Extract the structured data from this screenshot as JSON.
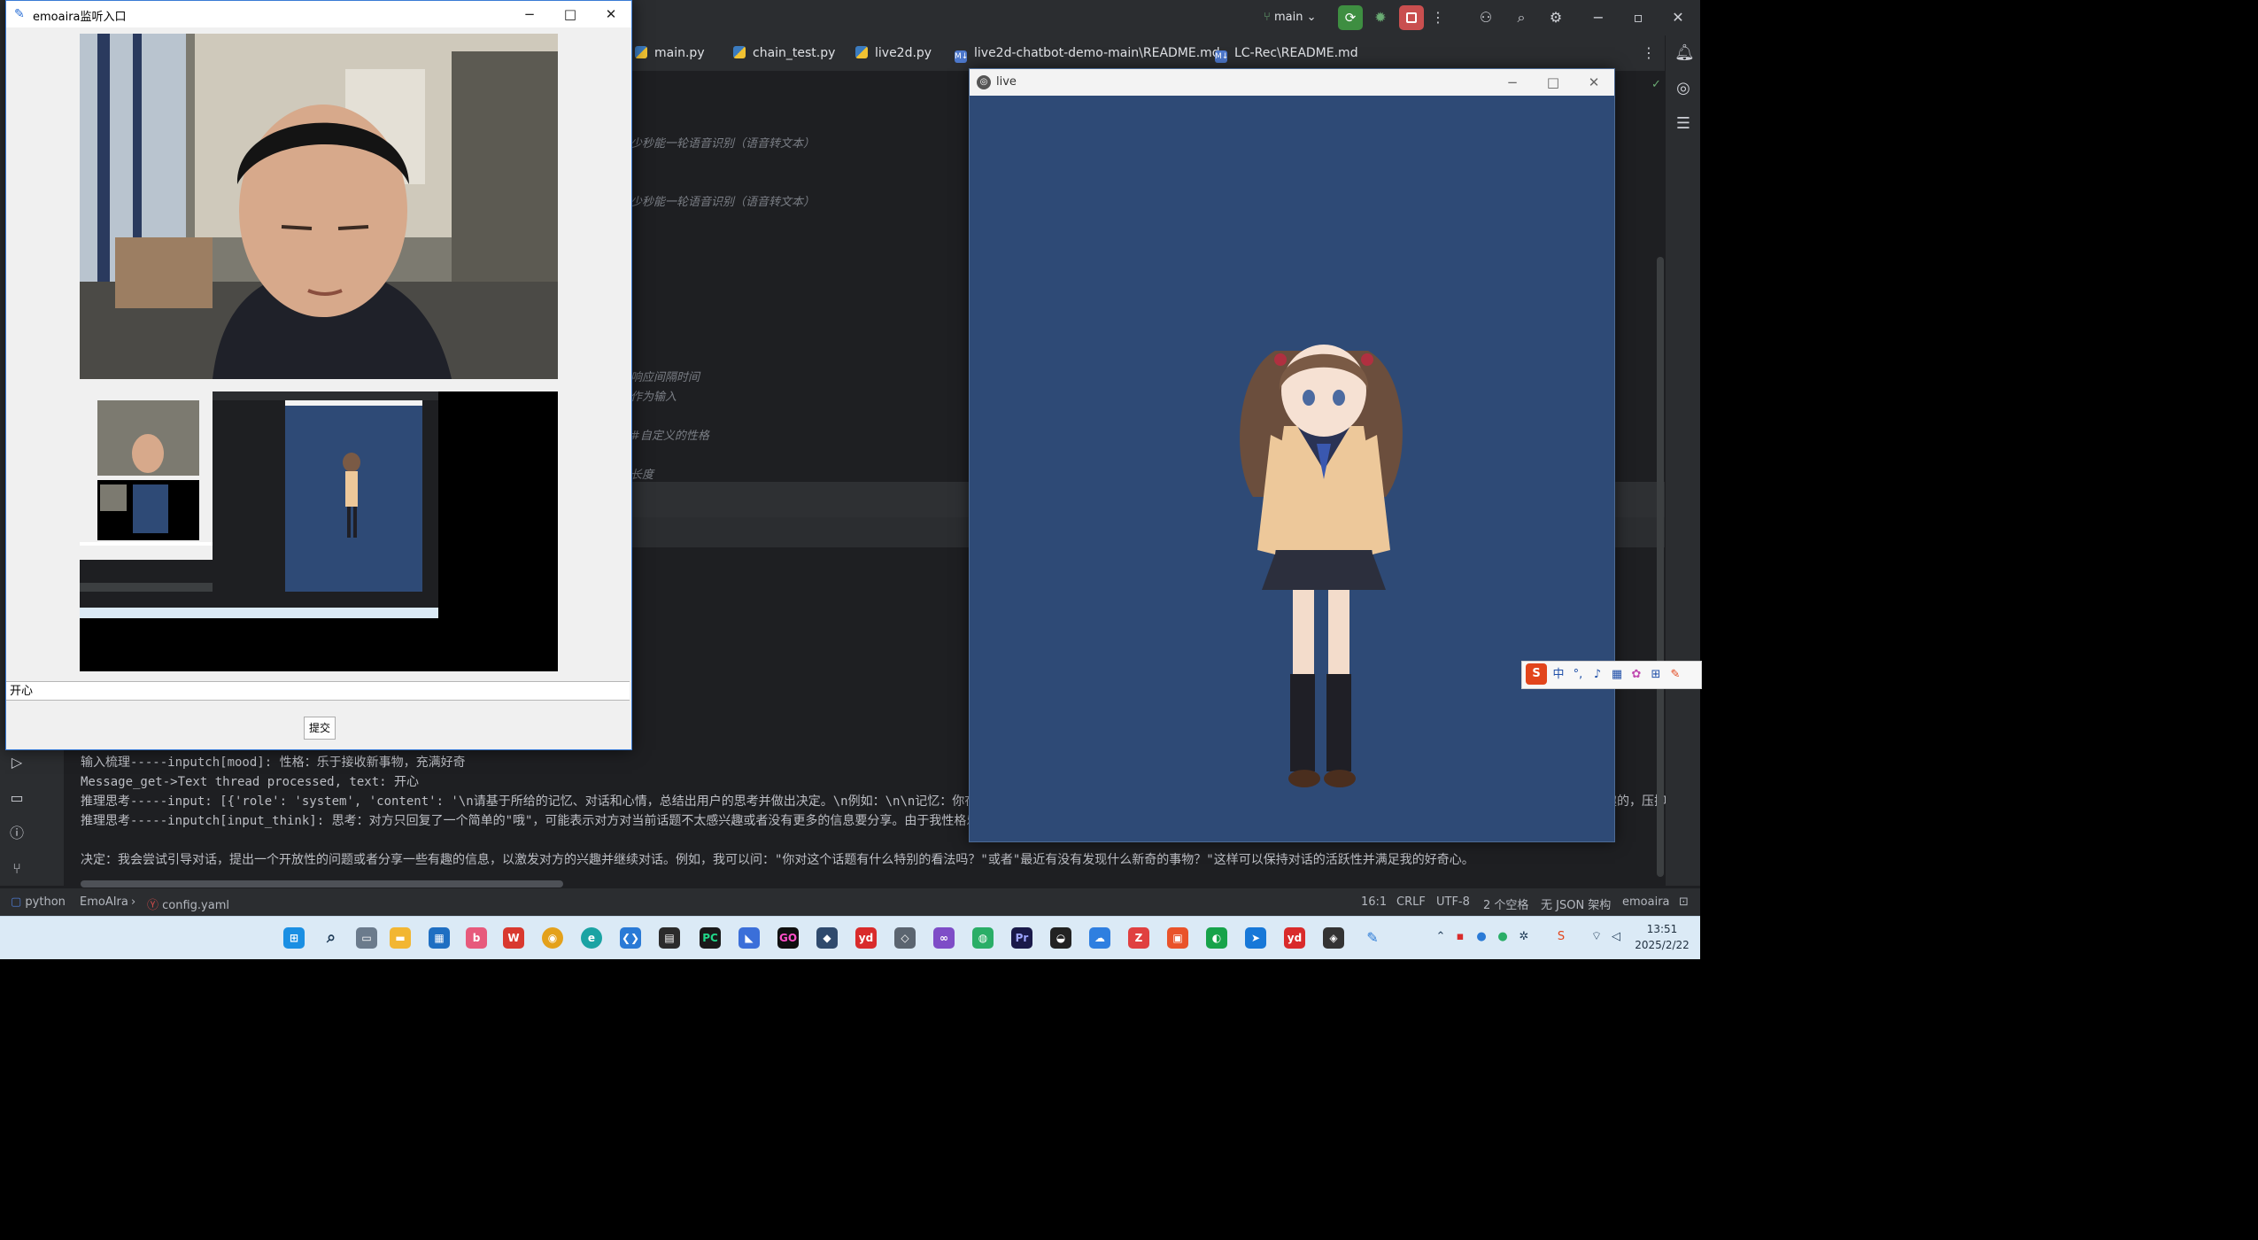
{
  "ide": {
    "branch": "main",
    "tabs": [
      {
        "label": "main.py",
        "kind": "py"
      },
      {
        "label": "chain_test.py",
        "kind": "py"
      },
      {
        "label": "live2d.py",
        "kind": "py"
      },
      {
        "label": "live2d-chatbot-demo-main\\README.md",
        "kind": "md"
      },
      {
        "label": "LC-Rec\\README.md",
        "kind": "md"
      }
    ],
    "code_fragments": [
      "少秒能一轮语音识别（语音转文本）",
      "少秒能一轮语音识别（语音转文本）",
      "响应间隔时间",
      "作为输入",
      "#自定义的性格",
      "长度"
    ],
    "console_lines": [
      "输入梳理-----inputch[mood]: 性格：乐于接收新事物，充满好奇",
      "Message_get->Text thread processed, text: 开心",
      "推理思考-----input: [{'role': 'system', 'content': '\\n请基于所给的记忆、对话和心情，总结出用户的思考并做出决定。\\n例如：\\n\\n记忆：你在和Jerry",
      "推理思考-----inputch[input_think]: 思考：对方只回复了一个简单的\"哦\"，可能表示对方对当前话题不太感兴趣或者没有更多的信息要分享。由于我性格乐于接收新",
      "",
      "决定：我会尝试引导对话，提出一个开放性的问题或者分享一些有趣的信息，以激发对方的兴趣并继续对话。例如，我可以问：\"你对这个话题有什么特别的看法吗？\"或者\"最近有没有发现什么新奇的事物？\"这样可以保持对话的活跃性并满足我的好奇心。"
    ],
    "console_overflow_suffixes": [
      "趣的，压抑",
      ""
    ],
    "status": {
      "interpreter": "python",
      "project": "EmoAIra",
      "file": "config.yaml",
      "position": "16:1",
      "line_sep": "CRLF",
      "encoding": "UTF-8",
      "indent": "2 个空格",
      "schema": "无 JSON 架构",
      "env": "emoaira"
    }
  },
  "emo_window": {
    "title": "emoaira监听入口",
    "input_value": "开心",
    "submit_label": "提交"
  },
  "live_window": {
    "title": "live",
    "background_color": "#2e4a76"
  },
  "taskbar": {
    "time": "13:51",
    "date": "2025/2/22"
  },
  "ime": {
    "mode_label": "中"
  }
}
